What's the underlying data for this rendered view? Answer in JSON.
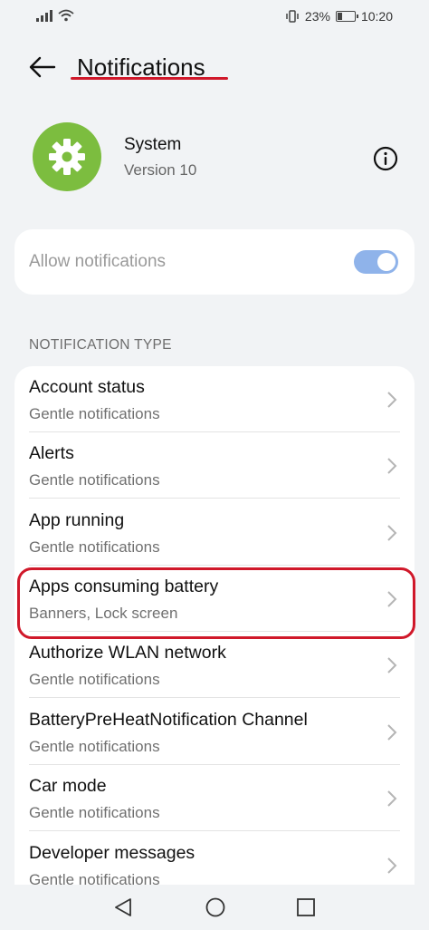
{
  "status_bar": {
    "battery_percent": "23%",
    "time": "10:20"
  },
  "header": {
    "title": "Notifications"
  },
  "app": {
    "name": "System",
    "version": "Version 10"
  },
  "allow": {
    "label": "Allow notifications",
    "enabled": true
  },
  "section": {
    "title": "NOTIFICATION TYPE"
  },
  "items": [
    {
      "title": "Account status",
      "subtitle": "Gentle notifications"
    },
    {
      "title": "Alerts",
      "subtitle": "Gentle notifications"
    },
    {
      "title": "App running",
      "subtitle": "Gentle notifications"
    },
    {
      "title": "Apps consuming battery",
      "subtitle": "Banners, Lock screen"
    },
    {
      "title": "Authorize WLAN network",
      "subtitle": "Gentle notifications"
    },
    {
      "title": "BatteryPreHeatNotification Channel",
      "subtitle": "Gentle notifications"
    },
    {
      "title": "Car mode",
      "subtitle": "Gentle notifications"
    },
    {
      "title": "Developer messages",
      "subtitle": "Gentle notifications"
    }
  ],
  "colors": {
    "accent_toggle": "#8fb3ea",
    "highlight": "#d0182a",
    "app_icon": "#7cbd3f"
  }
}
